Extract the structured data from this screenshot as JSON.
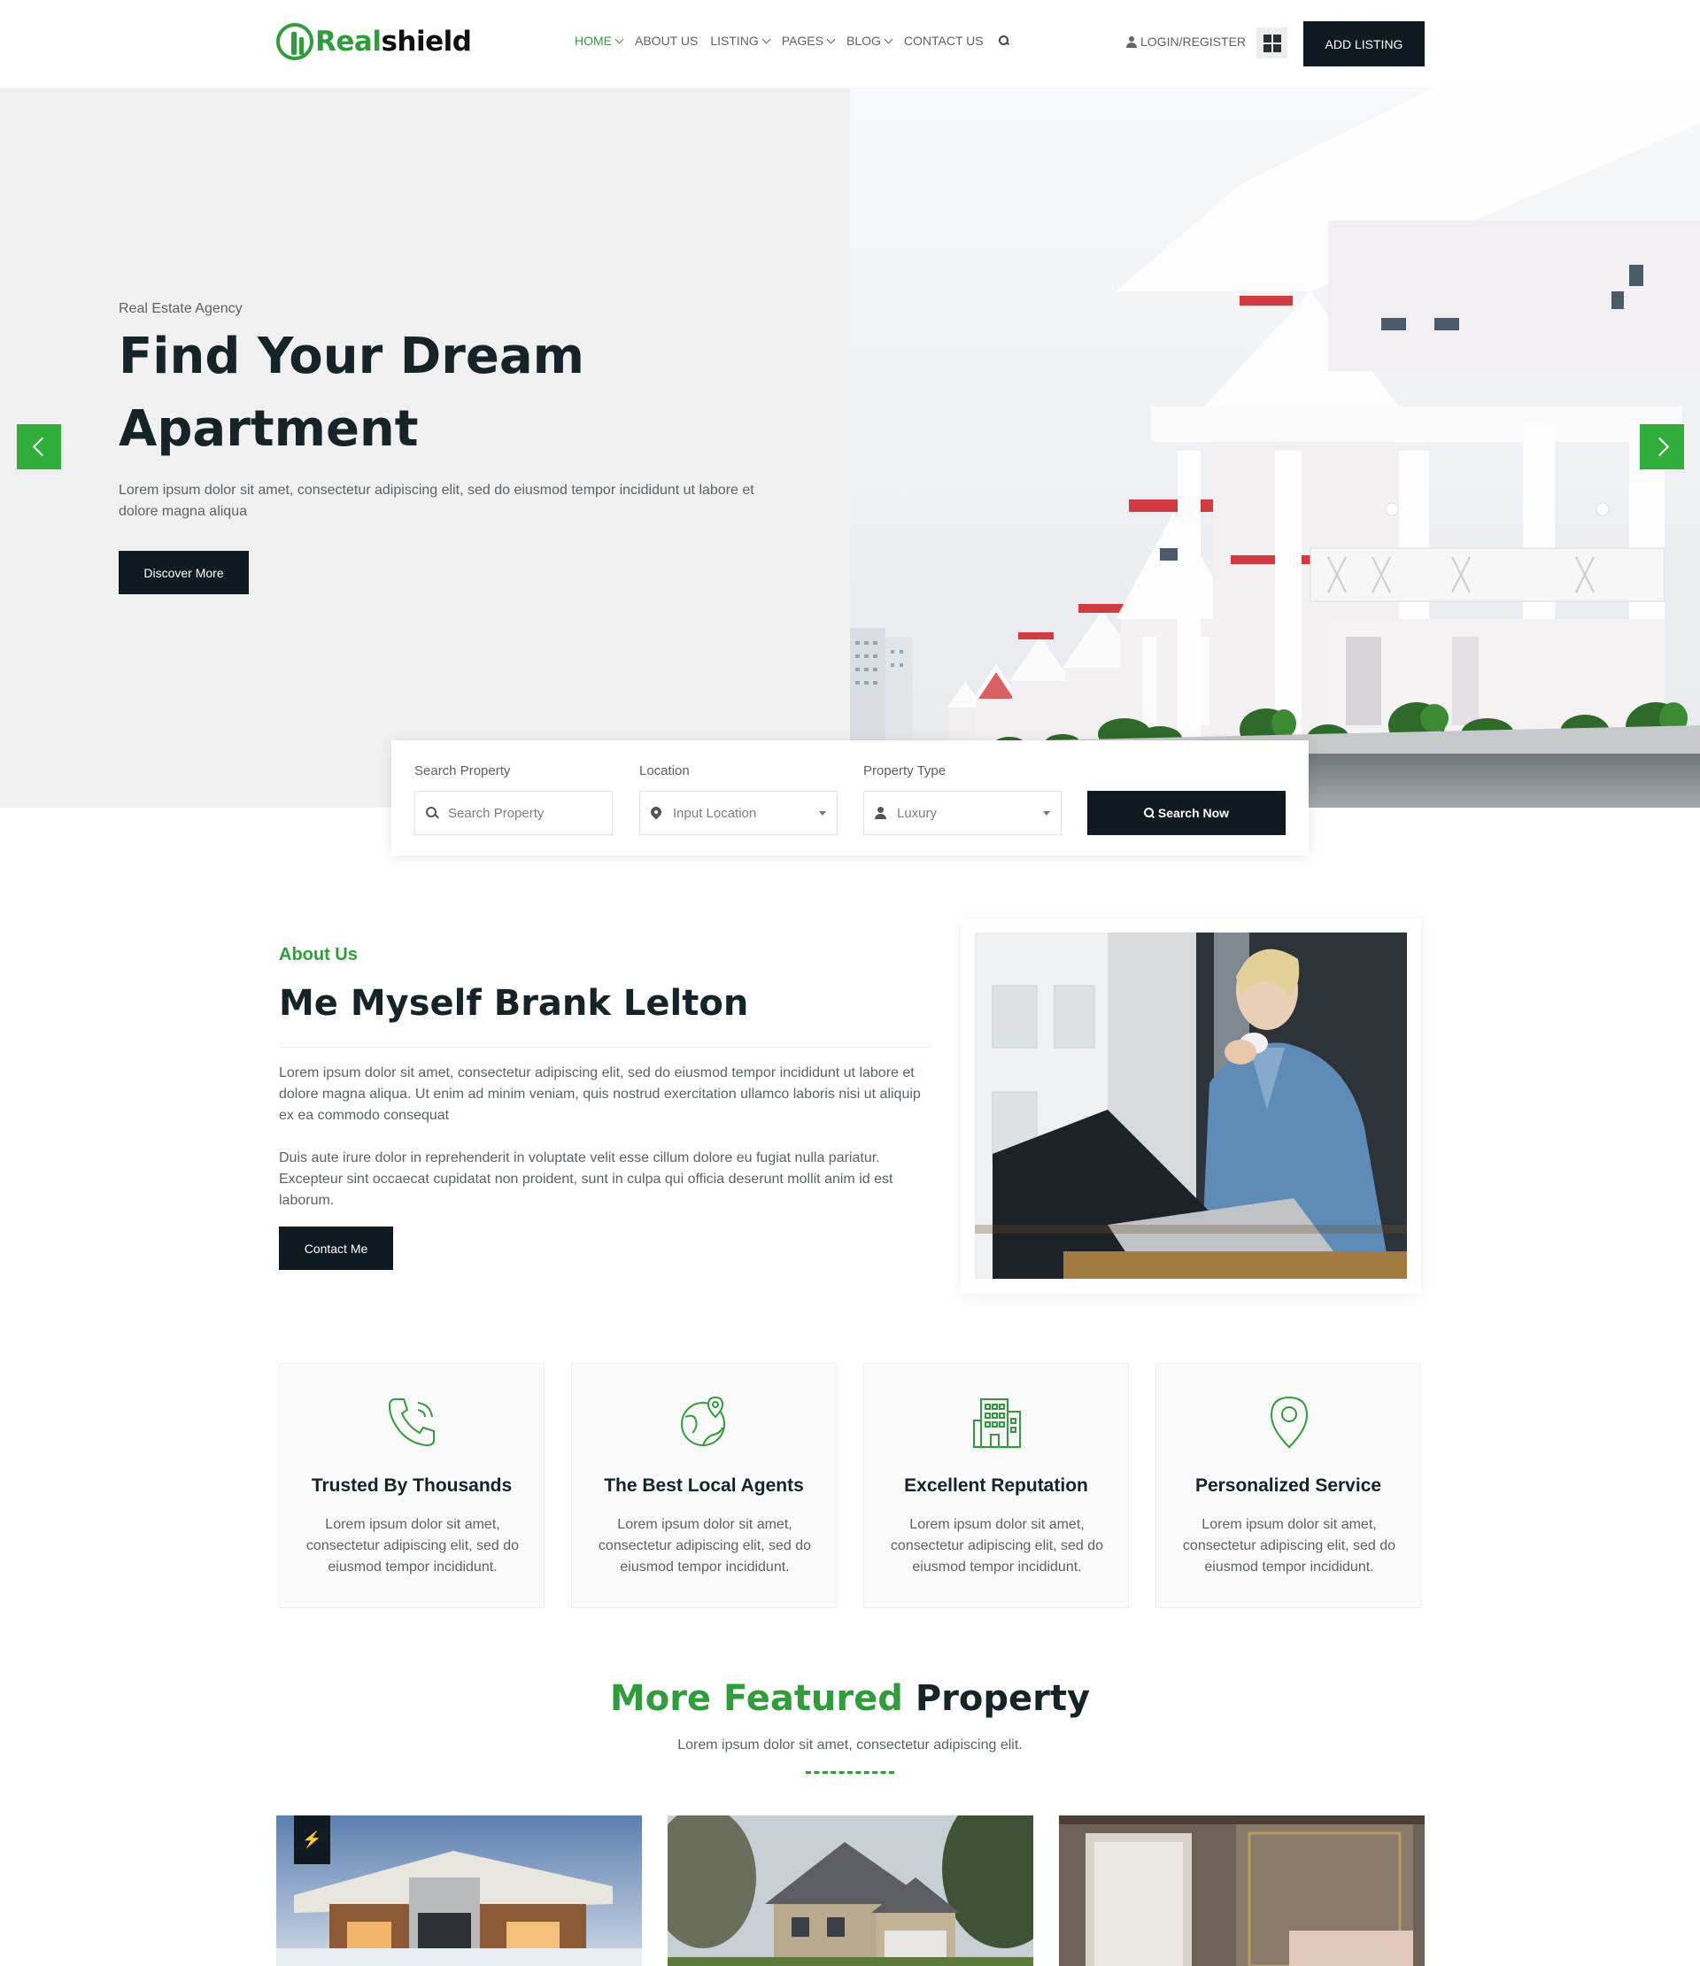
{
  "header": {
    "logo": {
      "part1": "Real",
      "part2": "shield"
    },
    "nav": [
      {
        "label": "HOME",
        "has_dropdown": true,
        "active": true
      },
      {
        "label": "ABOUT US",
        "has_dropdown": false
      },
      {
        "label": "LISTING",
        "has_dropdown": true
      },
      {
        "label": "PAGES",
        "has_dropdown": true
      },
      {
        "label": "BLOG",
        "has_dropdown": true
      },
      {
        "label": "CONTACT US",
        "has_dropdown": false
      }
    ],
    "login_label": "LOGIN/REGISTER",
    "add_listing_label": "ADD LISTING"
  },
  "hero": {
    "kicker": "Real Estate Agency",
    "title": "Find Your Dream Apartment",
    "description": "Lorem ipsum dolor sit amet, consectetur adipiscing elit, sed do eiusmod tempor incididunt ut labore et dolore magna aliqua",
    "button_label": "Discover More"
  },
  "search": {
    "property": {
      "label": "Search Property",
      "placeholder": "Search Property"
    },
    "location": {
      "label": "Location",
      "value": "Input Location"
    },
    "type": {
      "label": "Property Type",
      "value": "Luxury"
    },
    "button_label": "Search Now"
  },
  "about": {
    "kicker": "About Us",
    "title": "Me Myself Brank Lelton",
    "paragraph1": "Lorem ipsum dolor sit amet, consectetur adipiscing elit, sed do eiusmod tempor incididunt ut labore et dolore magna aliqua. Ut enim ad minim veniam, quis nostrud exercitation ullamco laboris nisi ut aliquip ex ea commodo consequat",
    "paragraph2": "Duis aute irure dolor in reprehenderit in voluptate velit esse cillum dolore eu fugiat nulla pariatur. Excepteur sint occaecat cupidatat non proident, sunt in culpa qui officia deserunt mollit anim id est laborum.",
    "button_label": "Contact Me"
  },
  "features": [
    {
      "icon": "phone-call-icon",
      "title": "Trusted By Thousands",
      "text": "Lorem ipsum dolor sit amet, consectetur adipiscing elit, sed do eiusmod tempor incididunt."
    },
    {
      "icon": "globe-pin-icon",
      "title": "The Best Local Agents",
      "text": "Lorem ipsum dolor sit amet, consectetur adipiscing elit, sed do eiusmod tempor incididunt."
    },
    {
      "icon": "building-icon",
      "title": "Excellent Reputation",
      "text": "Lorem ipsum dolor sit amet, consectetur adipiscing elit, sed do eiusmod tempor incididunt."
    },
    {
      "icon": "map-pin-icon",
      "title": "Personalized Service",
      "text": "Lorem ipsum dolor sit amet, consectetur adipiscing elit, sed do eiusmod tempor incididunt."
    }
  ],
  "featured": {
    "title_green": "More Featured",
    "title_dark": "Property",
    "subtitle": "Lorem ipsum dolor sit amet, consectetur adipiscing elit.",
    "badge_icon": "lightning-icon"
  },
  "colors": {
    "accent": "#2f9e3a",
    "dark": "#0f1b20",
    "arrow": "#2fae3c"
  }
}
